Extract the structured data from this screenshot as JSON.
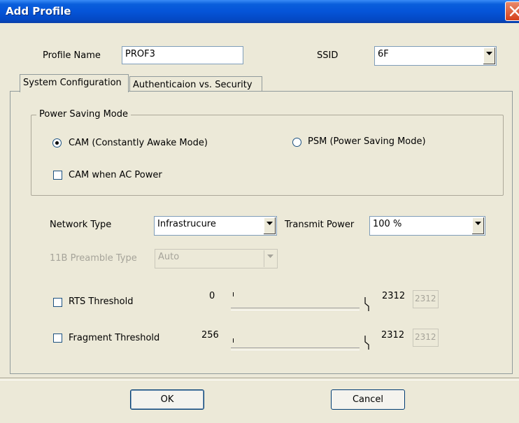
{
  "window": {
    "title": "Add Profile"
  },
  "profile": {
    "label": "Profile Name",
    "value": "PROF3"
  },
  "ssid": {
    "label": "SSID",
    "value": "6F"
  },
  "tabs": [
    {
      "label": "System Configuration",
      "active": true
    },
    {
      "label": "Authenticaion vs. Security",
      "active": false
    }
  ],
  "power_saving": {
    "group_label": "Power Saving Mode",
    "cam_label": "CAM (Constantly Awake Mode)",
    "cam_selected": true,
    "psm_label": "PSM (Power Saving Mode)",
    "psm_selected": false,
    "cam_ac_label": "CAM when AC Power",
    "cam_ac_checked": false
  },
  "network_type": {
    "label": "Network Type",
    "value": "Infrastrucure"
  },
  "transmit_power": {
    "label": "Transmit Power",
    "value": "100 %"
  },
  "preamble": {
    "label": "11B Preamble Type",
    "value": "Auto",
    "enabled": false
  },
  "rts": {
    "label": "RTS Threshold",
    "checked": false,
    "min": "0",
    "max": "2312",
    "value": "2312"
  },
  "fragment": {
    "label": "Fragment Threshold",
    "checked": false,
    "min": "256",
    "max": "2312",
    "value": "2312"
  },
  "buttons": {
    "ok": "OK",
    "cancel": "Cancel"
  },
  "colors": {
    "titlebar": "#0554d8",
    "dialog_bg": "#ece9d8",
    "close": "#d5401a"
  }
}
